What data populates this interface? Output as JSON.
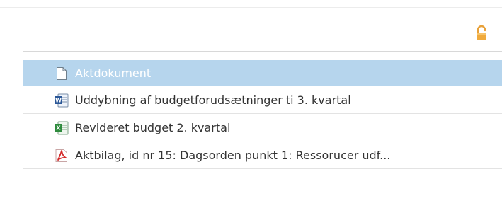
{
  "documents": [
    {
      "label": "Aktdokument",
      "icon": "blank-document-icon",
      "selected": true
    },
    {
      "label": "Uddybning af budgetforudsætninger ti 3. kvartal",
      "icon": "word-document-icon"
    },
    {
      "label": "Revideret budget 2. kvartal",
      "icon": "excel-spreadsheet-icon"
    },
    {
      "label": "Aktbilag, id nr 15: Dagsorden punkt 1: Ressorucer udf...",
      "icon": "pdf-document-icon"
    }
  ],
  "colors": {
    "selected_row": "#b6d5ed",
    "lock_icon": "#e8a13a",
    "word_blue": "#2b5797",
    "excel_green": "#2e8b3d",
    "pdf_red": "#d42a2a"
  },
  "header": {
    "lock_icon": "unlocked-padlock-icon"
  }
}
